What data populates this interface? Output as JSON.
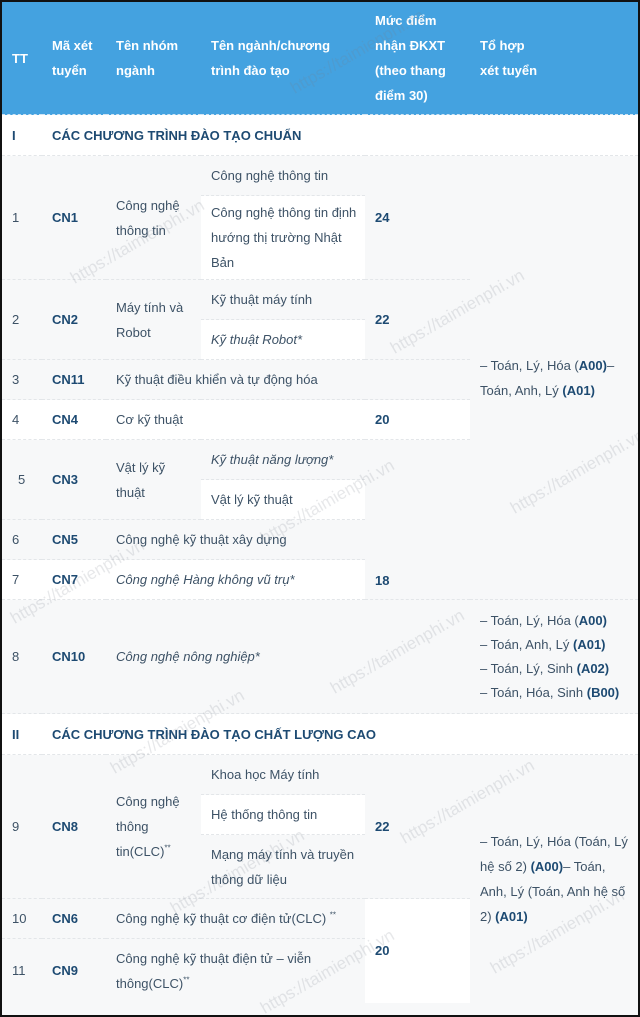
{
  "header": {
    "tt": "TT",
    "code": [
      "Mã xét",
      "tuyển"
    ],
    "group": [
      "Tên nhóm",
      "ngành"
    ],
    "program": [
      "Tên ngành/chương",
      "trình đào tạo"
    ],
    "score": [
      "Mức điểm",
      "nhận ĐKXT",
      "(theo thang",
      "điểm 30)"
    ],
    "combo": [
      "Tổ hợp",
      "xét tuyển"
    ]
  },
  "sections": [
    {
      "num": "I",
      "title": "CÁC CHƯƠNG TRÌNH ĐÀO TẠO CHUẨN"
    },
    {
      "num": "II",
      "title": "CÁC CHƯƠNG TRÌNH ĐÀO TẠO CHẤT LƯỢNG CAO"
    }
  ],
  "rows": [
    {
      "tt": "1",
      "code": "CN1",
      "group": "Công nghệ thông tin",
      "programs": [
        "Công nghệ thông tin",
        "Công nghệ thông tin định hướng thị trường Nhật Bản"
      ],
      "score": "24"
    },
    {
      "tt": "2",
      "code": "CN2",
      "group": "Máy tính và Robot",
      "programs": [
        "Kỹ thuật máy tính",
        "Kỹ thuật Robot*"
      ],
      "score": "22"
    },
    {
      "tt": "3",
      "code": "CN11",
      "group": "Kỹ thuật điều khiển và tự động hóa"
    },
    {
      "tt": "4",
      "code": "CN4",
      "group": "Cơ kỹ thuật",
      "score": "20"
    },
    {
      "tt": "5",
      "code": "CN3",
      "group": "Vật lý kỹ thuật",
      "programs": [
        "Kỹ thuật năng lượng*",
        "Vật lý kỹ thuật"
      ]
    },
    {
      "tt": "6",
      "code": "CN5",
      "group": "Công nghệ kỹ thuật xây dựng"
    },
    {
      "tt": "7",
      "code": "CN7",
      "group": "Công nghệ Hàng không vũ trụ*",
      "score": "18"
    },
    {
      "tt": "8",
      "code": "CN10",
      "group": "Công nghệ nông nghiệp*"
    },
    {
      "tt": "9",
      "code": "CN8",
      "group": "Công nghệ thông tin(CLC)",
      "group_sup": "**",
      "programs": [
        "Khoa học Máy tính",
        "Hệ thống thông tin",
        "Mạng máy tính và truyền thông dữ liệu"
      ],
      "score": "22"
    },
    {
      "tt": "10",
      "code": "CN6",
      "group": "Công nghệ kỹ thuật cơ điện tử(CLC) ",
      "group_sup": "**"
    },
    {
      "tt": "11",
      "code": "CN9",
      "group": "Công nghệ kỹ thuật điện tử – viễn thông(CLC)",
      "group_sup": "**",
      "score": "20"
    }
  ],
  "combos": {
    "a": {
      "t1": "– Toán, Lý, Hóa (",
      "c1": "A00)",
      "t2": "– Toán, Anh, Lý ",
      "c2": "(A01)"
    },
    "b": {
      "t1": "– Toán, Lý, Hóa (",
      "c1": "A00)",
      "t2": "– Toán, Anh, Lý ",
      "c2": "(A01)",
      "t3": "– Toán, Lý, Sinh ",
      "c3": "(A02)",
      "t4": "– Toán, Hóa, Sinh ",
      "c4": "(B00)"
    },
    "c": {
      "t1": "– Toán, Lý, Hóa (Toán, Lý hệ số 2) ",
      "c1": "(A00)",
      "t2": "– Toán, Anh, Lý (Toán, Anh hệ số 2) ",
      "c2": "(A01)"
    }
  },
  "watermark": "https://taimienphi.vn"
}
